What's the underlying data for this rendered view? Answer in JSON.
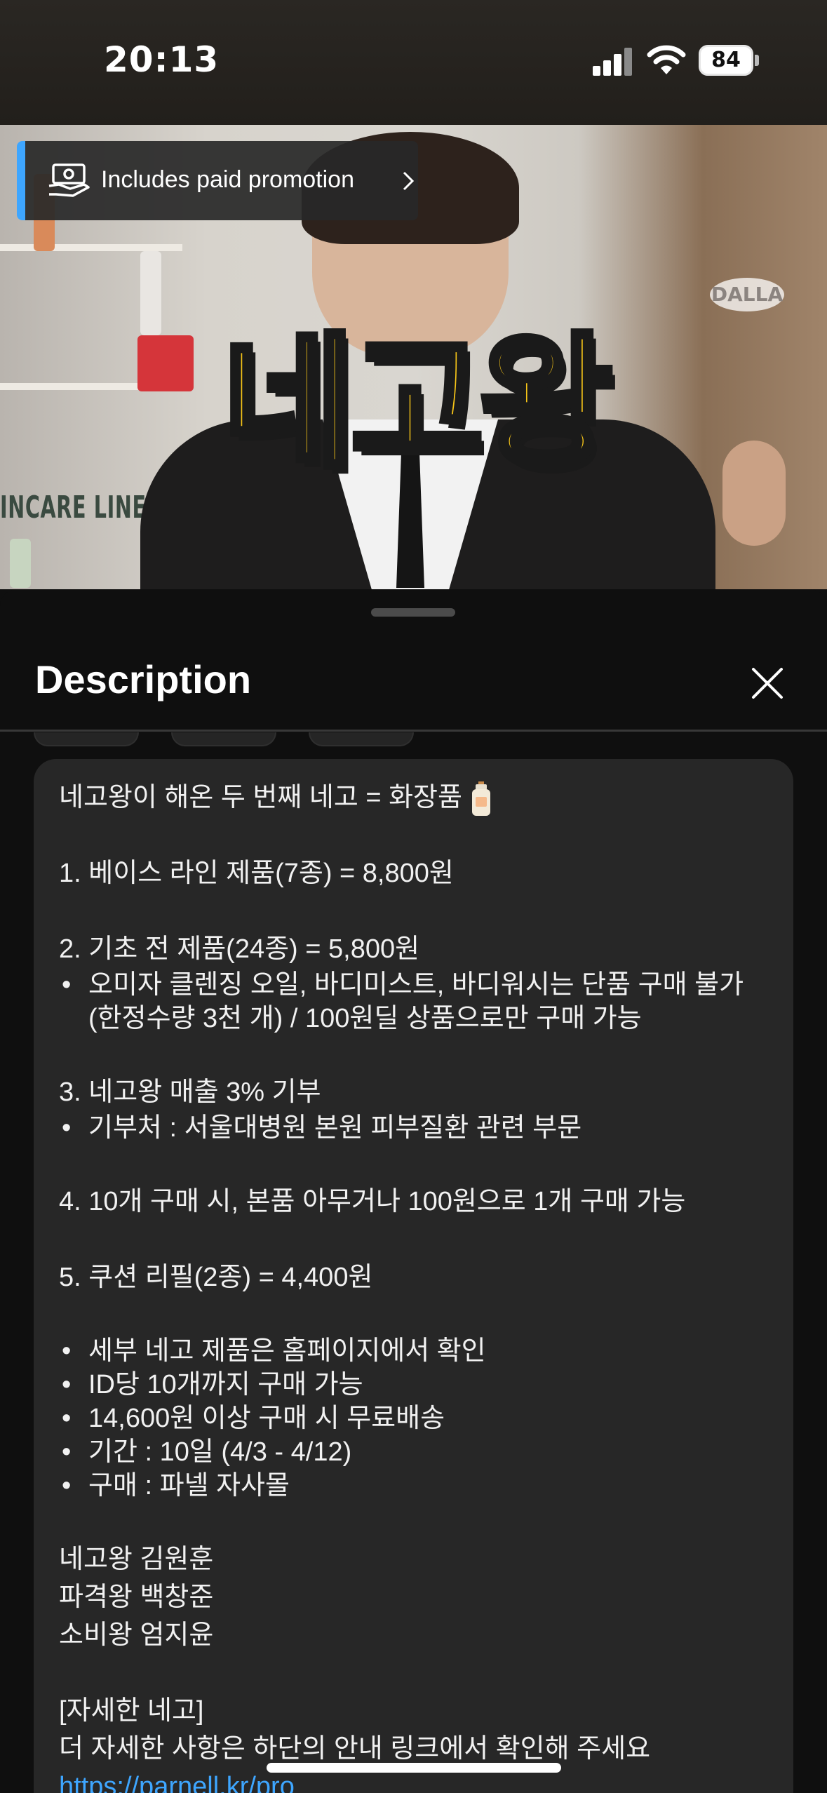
{
  "status_bar": {
    "time": "20:13",
    "battery": "84"
  },
  "video": {
    "promo_label": "Includes paid promotion",
    "headline": "네고왕",
    "watermark": "DALLA",
    "background_sign": "INCARE LINE"
  },
  "sheet": {
    "title": "Description"
  },
  "description": {
    "intro": "네고왕이 해온 두 번째 네고 = 화장품",
    "item1": "1. 베이스 라인 제품(7종) = 8,800원",
    "item2": "2. 기초 전 제품(24종) = 5,800원",
    "item2_note": "오미자 클렌징 오일, 바디미스트, 바디워시는 단품 구매 불가(한정수량 3천 개) / 100원딜 상품으로만 구매 가능",
    "item3": "3. 네고왕 매출 3% 기부",
    "item3_note": "기부처 : 서울대병원 본원 피부질환 관련 부문",
    "item4": "4. 10개 구매 시, 본품 아무거나 100원으로 1개 구매 가능",
    "item5": "5. 쿠션 리필(2종) = 4,400원",
    "notes": [
      "세부 네고 제품은 홈페이지에서 확인",
      "ID당 10개까지 구매 가능",
      "14,600원 이상 구매 시 무료배송",
      "기간 : 10일 (4/3 - 4/12)",
      "구매 : 파넬 자사몰"
    ],
    "credits": [
      "네고왕 김원훈",
      "파격왕 백창준",
      "소비왕 엄지윤"
    ],
    "detail_heading": "[자세한 네고]",
    "detail_text": "더 자세한 사항은 하단의 안내 링크에서 확인해 주세요",
    "link": "https://parnell.kr/pro"
  },
  "colors": {
    "accent_link": "#3ea6ff",
    "headline_yellow": "#f7c518",
    "card_bg": "#272727"
  },
  "icons": [
    "signal-icon",
    "wifi-icon",
    "battery-icon",
    "paid-promotion-icon",
    "chevron-right-icon",
    "close-icon",
    "lotion-emoji-icon"
  ]
}
